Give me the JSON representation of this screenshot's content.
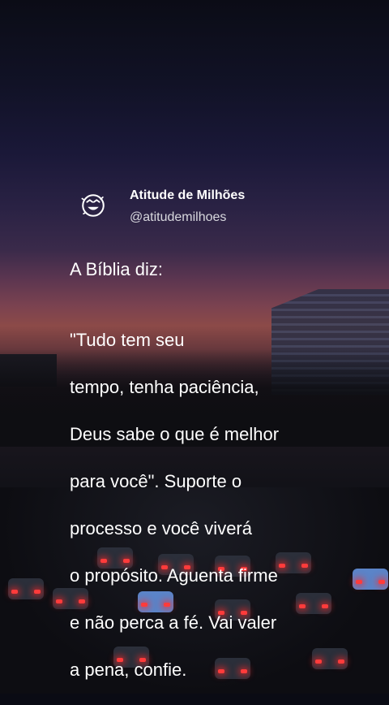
{
  "post": {
    "author_name": "Atitude de Milhões",
    "author_handle": "@atitudemilhoes",
    "avatar_icon": "smiley-face-icon",
    "intro": "A Bíblia diz:",
    "body_lines": [
      "\"Tudo tem seu",
      "tempo, tenha paciência,",
      "Deus sabe o que é melhor",
      "para você\".  Suporte o",
      "processo  e  você viverá",
      "o  propósito. Aguenta firme",
      "e não perca a fé. Vai valer",
      "a pena,   confie."
    ]
  },
  "colors": {
    "text": "#ffffff",
    "handle": "#d8d8de"
  }
}
